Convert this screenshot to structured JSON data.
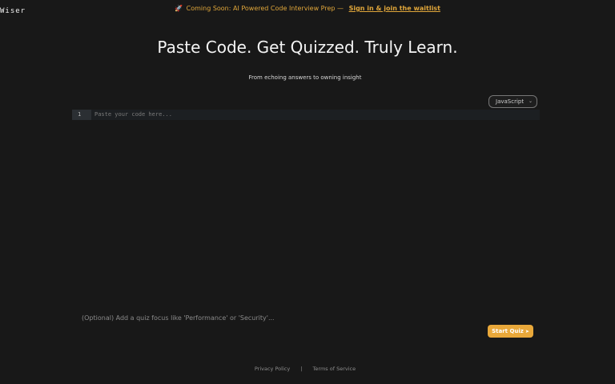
{
  "header": {
    "brand": "Wiser"
  },
  "banner": {
    "icon": "rocket-icon",
    "text": "Coming Soon: AI Powered Code Interview Prep —",
    "link_label": "Sign in & join the waitlist",
    "accent_color": "#e0a63a"
  },
  "hero": {
    "title": "Paste Code. Get Quizzed. Truly Learn.",
    "subtitle": "From echoing answers to owning insight"
  },
  "language_select": {
    "selected": "JavaScript"
  },
  "editor": {
    "line_number": "1",
    "placeholder": "Paste your code here..."
  },
  "quiz_focus": {
    "placeholder": "(Optional) Add a quiz focus like 'Performance' or 'Security'..."
  },
  "start_button": {
    "label": "Start Quiz",
    "icon": "arrow-right-icon",
    "color": "#e9a83a"
  },
  "footer": {
    "privacy": "Privacy Policy",
    "separator": "|",
    "terms": "Terms of Service"
  }
}
